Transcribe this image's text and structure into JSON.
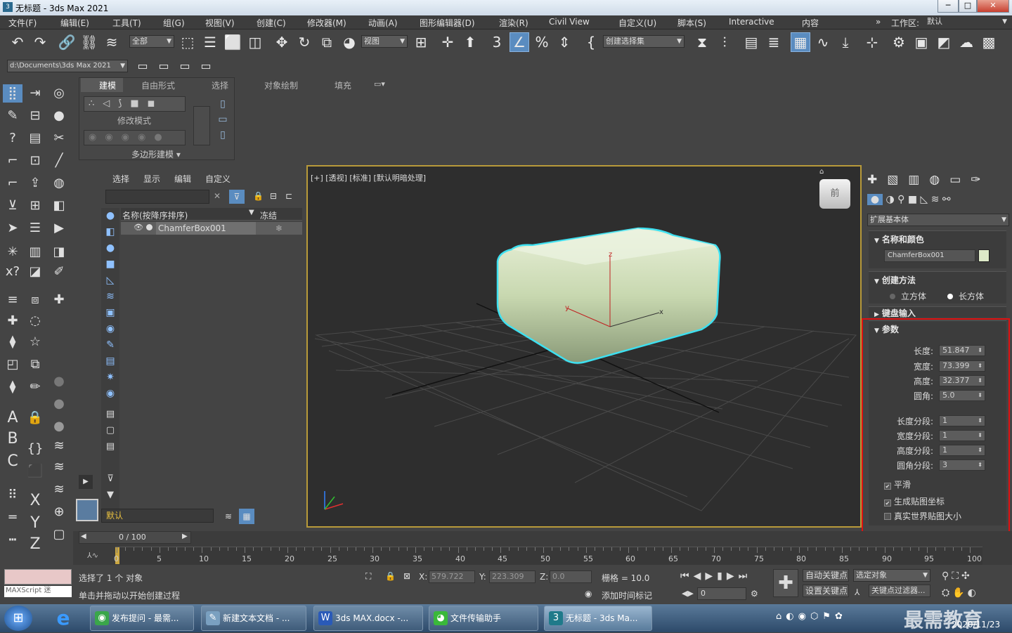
{
  "window": {
    "title": "无标题 - 3ds Max 2021",
    "min": "─",
    "max": "□",
    "close": "✕"
  },
  "menu": [
    "文件(F)",
    "编辑(E)",
    "工具(T)",
    "组(G)",
    "视图(V)",
    "创建(C)",
    "修改器(M)",
    "动画(A)",
    "图形编辑器(D)",
    "渲染(R)",
    "Civil View",
    "自定义(U)",
    "脚本(S)",
    "Interactive",
    "内容"
  ],
  "workspace": {
    "label": "工作区:",
    "value": "默认"
  },
  "toolbar": {
    "filter": "全部",
    "refcoord": "视图",
    "selset": "创建选择集",
    "path": "d:\\Documents\\3ds Max 2021"
  },
  "ribbon": {
    "tabs": [
      "建模",
      "自由形式",
      "选择",
      "对象绘制",
      "填充"
    ],
    "mode_label": "修改模式",
    "poly_label": "多边形建模 ▾"
  },
  "scene": {
    "tabs": [
      "选择",
      "显示",
      "编辑",
      "自定义"
    ],
    "col_name": "名称(按降序排序)",
    "col_freeze": "冻结",
    "object": "ChamferBox001",
    "layer": "默认"
  },
  "viewport": {
    "label": "[+] [透视] [标准] [默认明暗处理]",
    "cube": "前"
  },
  "panel": {
    "category": "扩展基本体",
    "name_color": {
      "header": "名称和颜色",
      "name": "ChamferBox001",
      "color": "#dde9c8"
    },
    "create_method": {
      "header": "创建方法",
      "opt1": "立方体",
      "opt2": "长方体"
    },
    "keyboard": {
      "header": "键盘输入"
    },
    "params": {
      "header": "参数",
      "length_label": "长度:",
      "length": "51.847",
      "width_label": "宽度:",
      "width": "73.399",
      "height_label": "高度:",
      "height": "32.377",
      "fillet_label": "圆角:",
      "fillet": "5.0",
      "lseg_label": "长度分段:",
      "lseg": "1",
      "wseg_label": "宽度分段:",
      "wseg": "1",
      "hseg_label": "高度分段:",
      "hseg": "1",
      "fseg_label": "圆角分段:",
      "fseg": "3",
      "smooth": "平滑",
      "mapcoords": "生成贴图坐标",
      "realworld": "真实世界贴图大小"
    }
  },
  "timeline": {
    "frame": "0 / 100",
    "ticks": [
      "0",
      "5",
      "10",
      "15",
      "20",
      "25",
      "30",
      "35",
      "40",
      "45",
      "50",
      "55",
      "60",
      "65",
      "70",
      "75",
      "80",
      "85",
      "90",
      "95",
      "100"
    ]
  },
  "status": {
    "selected": "选择了 1 个 对象",
    "prompt": "单击并拖动以开始创建过程",
    "maxscript": "MAXScript 迷",
    "x_label": "X:",
    "x": "579.722",
    "y_label": "Y:",
    "y": "223.309",
    "z_label": "Z:",
    "z": "0.0",
    "grid": "栅格 = 10.0",
    "addtime": "添加时间标记",
    "autokey": "自动关键点",
    "setkey": "设置关键点",
    "selobj": "选定对象",
    "keyfilter": "关键点过滤器...",
    "frame": "0"
  },
  "taskbar": {
    "items": [
      "发布提问 - 最需...",
      "新建文本文档 - ...",
      "3ds MAX.docx -...",
      "文件传输助手",
      "无标题 - 3ds Ma..."
    ],
    "date": "2020/11/23",
    "watermark": "最需教育"
  }
}
